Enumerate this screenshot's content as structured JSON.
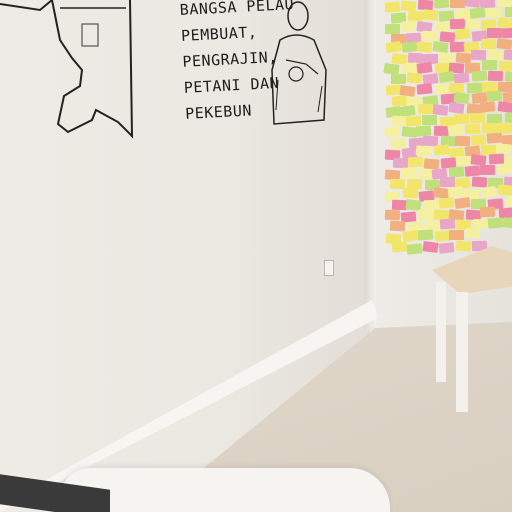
{
  "mural": {
    "lines": [
      "BANGSA PELAU",
      "PEMBUAT,",
      "PENGRAJIN,",
      "PETANI DAN",
      "PEKEBUN"
    ]
  },
  "colors": {
    "wall": "#ece8e2",
    "floor": "#dcd2c4",
    "note_yellow": "#f2e66a",
    "note_pink": "#ee86a8",
    "note_green": "#bfe07a",
    "note_orange": "#f2b080",
    "stool": "#e7d6b9"
  }
}
